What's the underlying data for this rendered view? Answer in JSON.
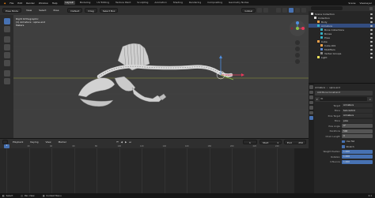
{
  "menu": {
    "items": [
      "File",
      "Edit",
      "Render",
      "Window",
      "Help"
    ],
    "workspaces": [
      "Layout",
      "Modeling",
      "UV Editing",
      "Texture Paint",
      "Sculpting",
      "Animation",
      "Shading",
      "Rendering",
      "Compositing",
      "Geometry Nodes"
    ],
    "active_workspace": "Layout",
    "scene_label": "Scene",
    "view_layer_label": "ViewLayer"
  },
  "header": {
    "mode": "Pose Mode",
    "view": "View",
    "select": "Select",
    "pose": "Pose",
    "orientation": "Default",
    "drag": "Drag",
    "pivot": "Select Box",
    "global": "Global"
  },
  "viewport": {
    "view_name": "Right Orthographic",
    "object_info": "(1) Armature : spine.end",
    "units": "Meters",
    "colors": {
      "bg": "#3f3f3f",
      "bone": "#d7d7d7",
      "bone_shadow": "#8e8e8e",
      "grid_x": "#b0b43a",
      "gizmo_x": "#e8385a",
      "gizmo_y": "#8bc34a",
      "gizmo_z": "#4f8fe0"
    }
  },
  "outliner": {
    "header": "Scene Collection",
    "items": [
      {
        "label": "Scene Collection",
        "icon": "collection-icon",
        "indent": 0
      },
      {
        "label": "Collection",
        "icon": "collection-icon",
        "indent": 1
      },
      {
        "label": "Body",
        "icon": "mesh-icon",
        "indent": 2
      },
      {
        "label": "Armature",
        "icon": "armature-icon",
        "indent": 2
      },
      {
        "label": "Bone Collections",
        "icon": "bone-icon",
        "indent": 3
      },
      {
        "label": "Bones",
        "icon": "bone-icon",
        "indent": 3
      },
      {
        "label": "Pose",
        "icon": "pose-icon",
        "indent": 3
      },
      {
        "label": "Cube",
        "icon": "mesh-icon",
        "indent": 2
      },
      {
        "label": "Cube.001",
        "icon": "mesh-icon",
        "indent": 3
      },
      {
        "label": "Modifiers",
        "icon": "wrench-icon",
        "indent": 3
      },
      {
        "label": "Vertex Groups",
        "icon": "vertex-icon",
        "indent": 3
      },
      {
        "label": "Light",
        "icon": "light-icon",
        "indent": 2
      }
    ]
  },
  "properties": {
    "breadcrumb_object": "Armature",
    "breadcrumb_bone": "spine.end",
    "add_constraint": "Add Bone Constraint",
    "constraint_name": "IK",
    "rows": [
      {
        "label": "Target",
        "value": "Armature",
        "style": "dark"
      },
      {
        "label": "Bone",
        "value": "tail.control",
        "style": "dark"
      },
      {
        "label": "Pole Target",
        "value": "Armature",
        "style": "dark"
      },
      {
        "label": "Bone",
        "value": "pole",
        "style": "dark"
      },
      {
        "label": "Pole Angle",
        "value": "0°",
        "style": "normal"
      },
      {
        "label": "Iterations",
        "value": "500",
        "style": "normal"
      },
      {
        "label": "Chain Length",
        "value": "0",
        "style": "normal"
      },
      {
        "label": "",
        "value": "Use Tail",
        "style": "check"
      },
      {
        "label": "",
        "value": "Stretch",
        "style": "check"
      },
      {
        "label": "Weight Position",
        "value": "1.000",
        "style": "blue"
      },
      {
        "label": "Rotation",
        "value": "1.000",
        "style": "blue"
      },
      {
        "label": "Influence",
        "value": "1.000",
        "style": "blue"
      }
    ]
  },
  "timeline": {
    "playback": "Playback",
    "keying": "Keying",
    "view": "View",
    "marker": "Marker",
    "current_frame": "1",
    "start_label": "Start",
    "start": "1",
    "end_label": "End",
    "end": "250",
    "ticks": [
      "0",
      "20",
      "40",
      "60",
      "80",
      "100",
      "120",
      "140",
      "160",
      "180",
      "200",
      "220",
      "240"
    ]
  },
  "status": {
    "select": "Select",
    "pan_view": "Pan View",
    "context_menu": "Context Menu",
    "version": "4.1"
  }
}
